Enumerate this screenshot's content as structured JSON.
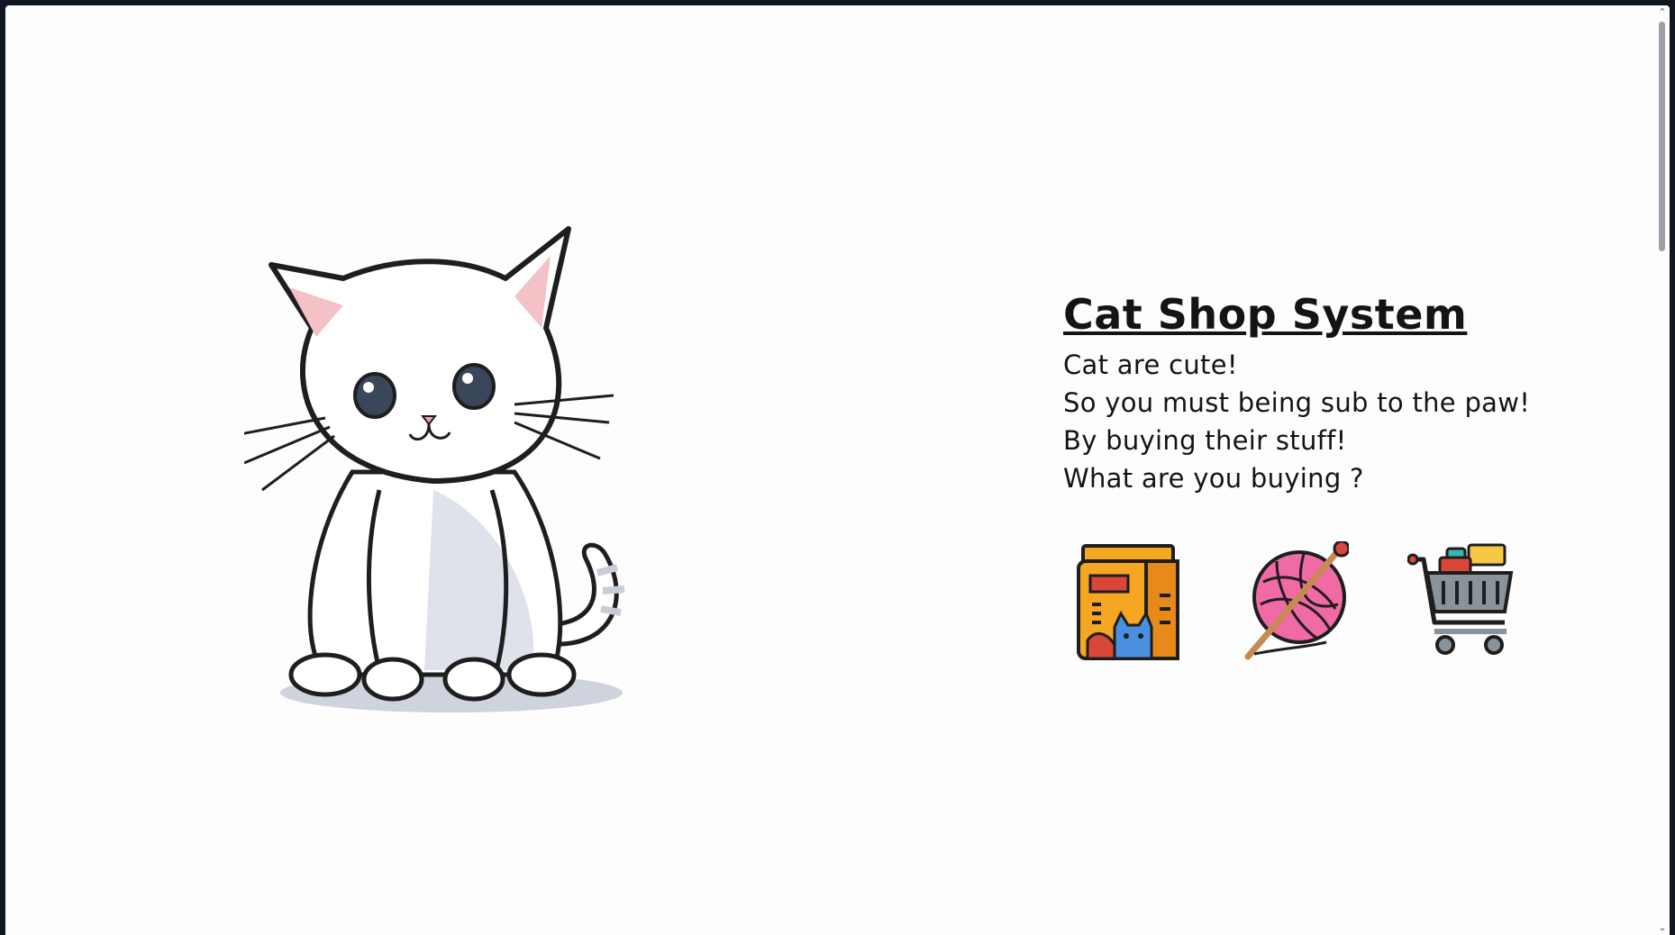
{
  "page": {
    "title": "Cat Shop System",
    "lines": [
      "Cat are cute!",
      "So you must being sub to the paw!",
      "By buying their stuff!",
      "What are you buying ?"
    ]
  },
  "shop_items": [
    {
      "icon": "cat-food-bag-icon"
    },
    {
      "icon": "yarn-ball-icon"
    },
    {
      "icon": "shopping-cart-icon"
    }
  ],
  "scrollbar": {
    "up_arrow": "⌃",
    "down_arrow": "⌄"
  },
  "colors": {
    "background": "#fdfdfd",
    "frame": "#0f1620",
    "text": "#141414",
    "cat_food_orange": "#f5a623",
    "yarn_pink": "#f06aa6",
    "cart_gray": "#8a929a"
  }
}
